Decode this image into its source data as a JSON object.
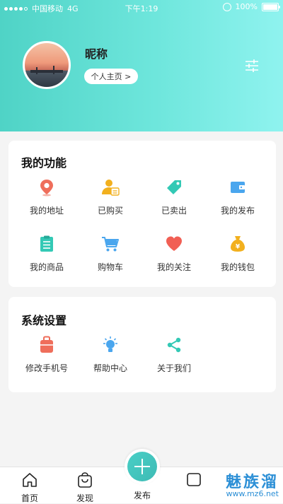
{
  "status_bar": {
    "carrier": "中国移动",
    "network": "4G",
    "time": "下午1:19",
    "battery": "100%"
  },
  "profile": {
    "nickname": "昵称",
    "home_button": "个人主页 >"
  },
  "my_functions": {
    "title": "我的功能",
    "items": [
      {
        "label": "我的地址",
        "icon": "location-pin-icon"
      },
      {
        "label": "已购买",
        "icon": "purchased-user-icon"
      },
      {
        "label": "已卖出",
        "icon": "price-tag-icon"
      },
      {
        "label": "我的发布",
        "icon": "wallet-card-icon"
      },
      {
        "label": "我的商品",
        "icon": "clipboard-list-icon"
      },
      {
        "label": "购物车",
        "icon": "shopping-cart-icon"
      },
      {
        "label": "我的关注",
        "icon": "heart-icon"
      },
      {
        "label": "我的钱包",
        "icon": "money-bag-icon"
      }
    ]
  },
  "system_settings": {
    "title": "系统设置",
    "items": [
      {
        "label": "修改手机号",
        "icon": "phone-case-icon"
      },
      {
        "label": "帮助中心",
        "icon": "lightbulb-icon"
      },
      {
        "label": "关于我们",
        "icon": "share-icon"
      }
    ]
  },
  "bottom_nav": {
    "home": "首页",
    "discover": "发现",
    "publish": "发布"
  },
  "watermark": {
    "text": "魅族溜",
    "url": "www.mz6.net"
  },
  "colors": {
    "accent": "#4fd3c6",
    "header_gradient_end": "#8ff3ef"
  }
}
